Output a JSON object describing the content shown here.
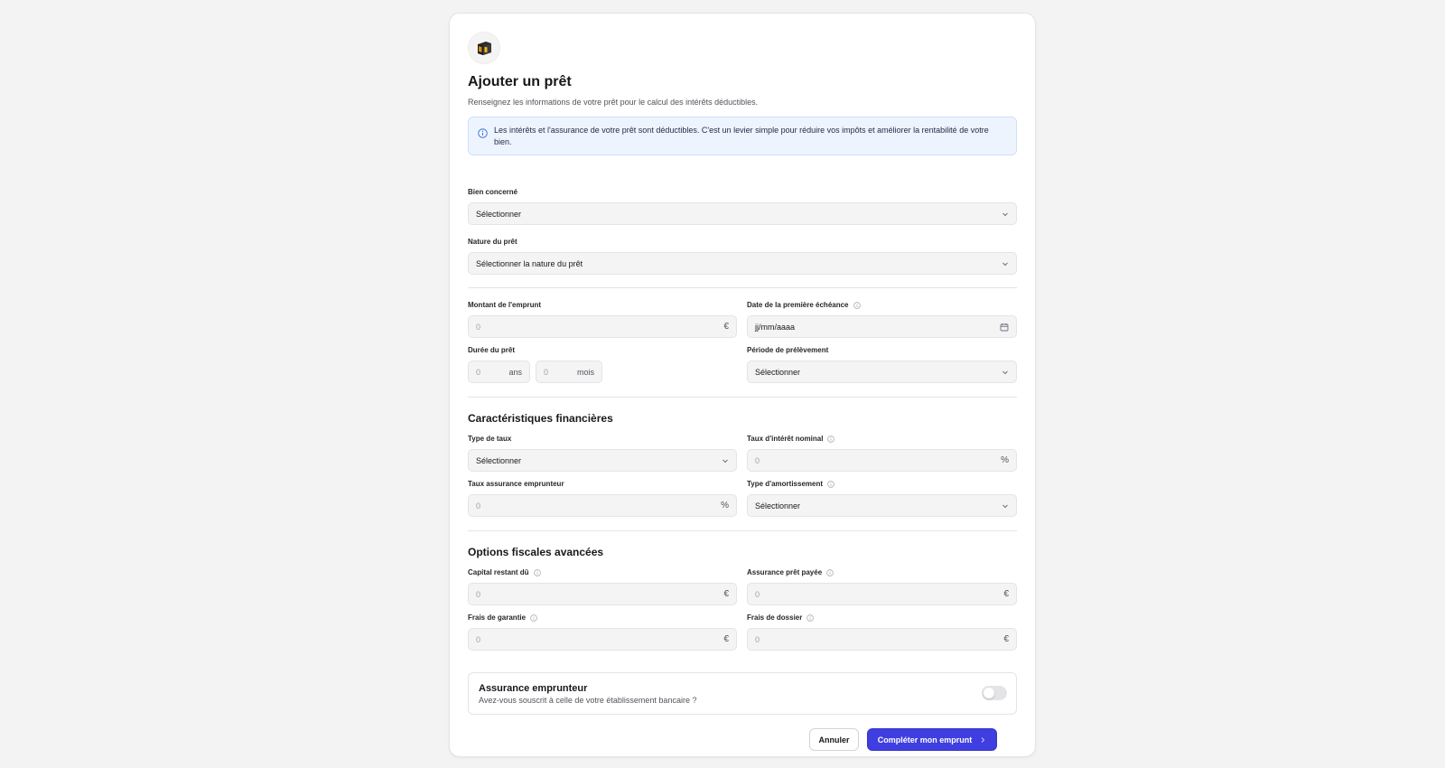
{
  "dialog": {
    "title": "Ajouter un prêt",
    "subtitle": "Renseignez les informations de votre prêt pour le calcul des intérêts déductibles.",
    "info_text": "Les intérêts et l'assurance de votre prêt sont déductibles. C'est un levier simple pour réduire vos impôts et améliorer la rentabilité de votre bien."
  },
  "fields": {
    "bien": {
      "label": "Bien concerné",
      "value": "Sélectionner"
    },
    "nature": {
      "label": "Nature du prêt",
      "value": "Sélectionner la nature du prêt"
    },
    "montant": {
      "label": "Montant de l'emprunt",
      "placeholder": "0",
      "suffix": "€"
    },
    "date": {
      "label": "Date de la première échéance",
      "value": "jj/mm/aaaa"
    },
    "duree": {
      "label": "Durée du prêt",
      "years_placeholder": "0",
      "years_suffix": "ans",
      "months_placeholder": "0",
      "months_suffix": "mois"
    },
    "periode": {
      "label": "Période de prélèvement",
      "value": "Sélectionner"
    }
  },
  "financial": {
    "section_title": "Caractéristiques financières",
    "type_taux": {
      "label": "Type de taux",
      "value": "Sélectionner"
    },
    "taux_nominal": {
      "label": "Taux d'intérêt nominal",
      "placeholder": "0",
      "suffix": "%"
    },
    "taux_assurance": {
      "label": "Taux assurance emprunteur",
      "placeholder": "0",
      "suffix": "%"
    },
    "amortissement": {
      "label": "Type d'amortissement",
      "value": "Sélectionner"
    }
  },
  "fiscal": {
    "section_title": "Options fiscales avancées",
    "capital": {
      "label": "Capital restant dû",
      "placeholder": "0",
      "suffix": "€"
    },
    "assurance_payee": {
      "label": "Assurance prêt payée",
      "placeholder": "0",
      "suffix": "€"
    },
    "frais_garantie": {
      "label": "Frais de garantie",
      "placeholder": "0",
      "suffix": "€"
    },
    "frais_dossier": {
      "label": "Frais de dossier",
      "placeholder": "0",
      "suffix": "€"
    }
  },
  "insurance_toggle": {
    "title": "Assurance emprunteur",
    "description": "Avez-vous souscrit à celle de votre établissement bancaire ?",
    "enabled": false
  },
  "actions": {
    "cancel_label": "Annuler",
    "submit_label": "Compléter mon emprunt"
  },
  "colors": {
    "primary": "#3f3ee0",
    "info_bg": "#eef4fe",
    "field_bg": "#f4f4f5"
  }
}
